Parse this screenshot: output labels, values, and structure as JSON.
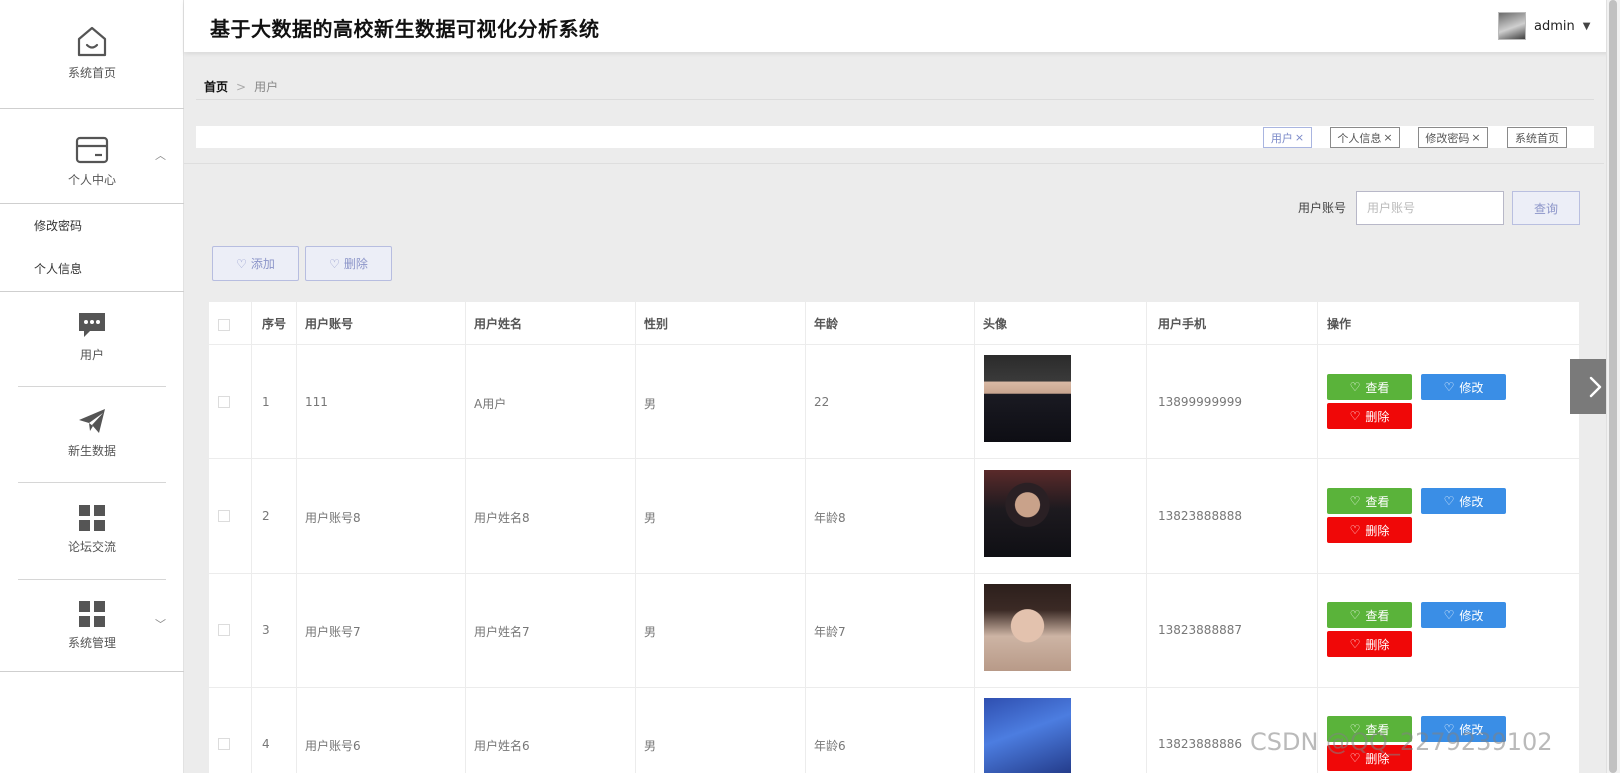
{
  "app": {
    "title": "基于大数据的高校新生数据可视化分析系统",
    "user": "admin"
  },
  "sidebar": {
    "home": "系统首页",
    "personal_center": "个人中心",
    "sub_items": [
      "修改密码",
      "个人信息"
    ],
    "users": "用户",
    "new_students": "新生数据",
    "forum": "论坛交流",
    "system_admin": "系统管理"
  },
  "breadcrumb": {
    "home": "首页",
    "separator": ">",
    "current": "用户"
  },
  "tabs": [
    {
      "label": "用户",
      "closable": true
    },
    {
      "label": "个人信息",
      "closable": true
    },
    {
      "label": "修改密码",
      "closable": true
    },
    {
      "label": "系统首页",
      "closable": false
    }
  ],
  "search": {
    "label": "用户账号",
    "placeholder": "用户账号",
    "button": "查询"
  },
  "toolbar": {
    "add": "添加",
    "delete": "删除"
  },
  "table": {
    "headers": [
      "序号",
      "用户账号",
      "用户姓名",
      "性别",
      "年龄",
      "头像",
      "用户手机",
      "操作"
    ],
    "rows": [
      {
        "index": "1",
        "account": "111",
        "name": "A用户",
        "gender": "男",
        "age": "22",
        "phone": "13899999999"
      },
      {
        "index": "2",
        "account": "用户账号8",
        "name": "用户姓名8",
        "gender": "男",
        "age": "年龄8",
        "phone": "13823888888"
      },
      {
        "index": "3",
        "account": "用户账号7",
        "name": "用户姓名7",
        "gender": "男",
        "age": "年龄7",
        "phone": "13823888887"
      },
      {
        "index": "4",
        "account": "用户账号6",
        "name": "用户姓名6",
        "gender": "男",
        "age": "年龄6",
        "phone": "13823888886"
      }
    ],
    "actions": {
      "view": "查看",
      "edit": "修改",
      "delete": "删除"
    }
  },
  "watermark": "CSDN @QQ_2279239102",
  "colors": {
    "view": "#5ab33a",
    "edit": "#3a8ee6",
    "delete": "#f00808",
    "accent": "#8c95c9"
  }
}
